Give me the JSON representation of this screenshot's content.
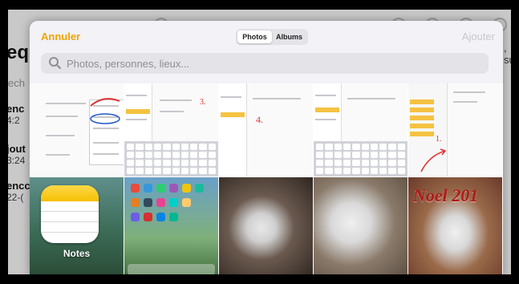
{
  "background": {
    "title": "eq",
    "search_hint": "ech",
    "rows": [
      {
        "title": "enc",
        "sub": "4:2"
      },
      {
        "title": "jout",
        "sub": "3:24"
      },
      {
        "title": "encc",
        "sub": "22-("
      }
    ],
    "right_text": ", su"
  },
  "picker": {
    "cancel_label": "Annuler",
    "add_label": "Ajouter",
    "tabs": [
      {
        "label": "Photos",
        "active": true
      },
      {
        "label": "Albums",
        "active": false
      }
    ],
    "search": {
      "placeholder": "Photos, personnes, lieux..."
    }
  },
  "grid": {
    "annotations": {
      "step3": "3.",
      "step4": "4.",
      "step1": "1."
    },
    "notes_app_label": "Notes",
    "last_photo_caption": "Noel 201"
  },
  "colors": {
    "accent": "#f0a500",
    "sheet_bg": "#f2f2f7",
    "notes_yellow": "#f5c000"
  }
}
